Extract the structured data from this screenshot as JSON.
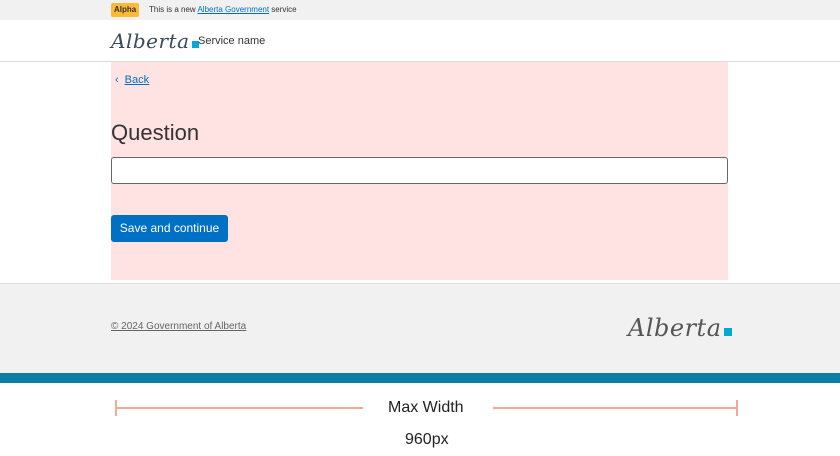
{
  "phase_banner": {
    "badge": "Alpha",
    "text_before": "This is a new ",
    "link_text": "Alberta Government",
    "text_after": " service",
    "badge_color": "#feba35"
  },
  "header": {
    "logo_text": "Alberta",
    "service_name": "Service name"
  },
  "main": {
    "back_label": "Back",
    "back_icon": "chevron-left-icon",
    "question_title": "Question",
    "input_value": "",
    "save_button_label": "Save and continue",
    "background_color": "#ffe2e2"
  },
  "footer": {
    "copyright": "© 2024 Government of Alberta",
    "logo_text": "Alberta",
    "band_color": "#0a7ea5"
  },
  "annotation": {
    "label": "Max Width",
    "value": "960px"
  },
  "colors": {
    "primary": "#0070c4",
    "logo_accent": "#00aad2",
    "annotation_line": "#f4a89a"
  }
}
